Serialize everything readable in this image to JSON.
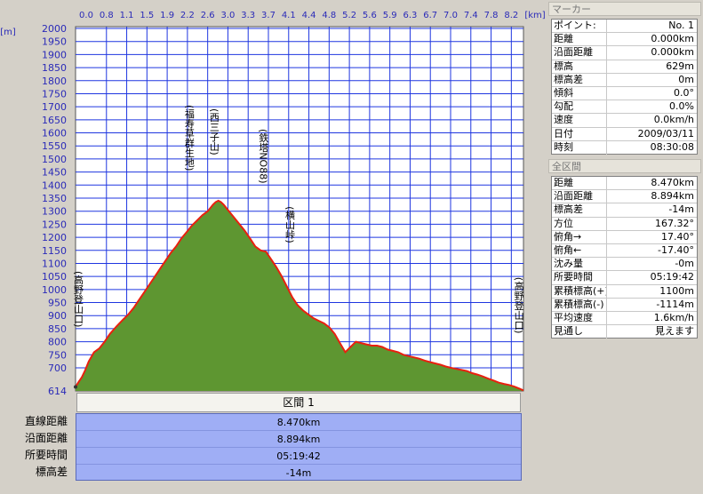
{
  "chart_data": {
    "type": "area",
    "x_unit": "[km]",
    "y_unit": "[m]",
    "x_ticks": [
      "0.0",
      "0.8",
      "1.1",
      "1.5",
      "1.9",
      "2.2",
      "2.6",
      "3.0",
      "3.3",
      "3.7",
      "4.1",
      "4.4",
      "4.8",
      "5.2",
      "5.6",
      "5.9",
      "6.3",
      "6.7",
      "7.0",
      "7.4",
      "7.8",
      "8.2"
    ],
    "y_ticks": [
      2000,
      1950,
      1900,
      1850,
      1800,
      1750,
      1700,
      1650,
      1600,
      1550,
      1500,
      1450,
      1400,
      1350,
      1300,
      1250,
      1200,
      1150,
      1100,
      1050,
      1000,
      950,
      900,
      850,
      800,
      750,
      700
    ],
    "y_min_label": "614",
    "xlim": [
      0,
      8.47
    ],
    "ylim": [
      614,
      2000
    ],
    "fill_color": "#5e9631",
    "line_color": "#e8200f",
    "grid_color": "#1f36e0",
    "plot_bg": "#ffffff",
    "x": [
      0.0,
      0.05,
      0.12,
      0.18,
      0.25,
      0.35,
      0.45,
      0.55,
      0.65,
      0.78,
      0.9,
      1.0,
      1.1,
      1.2,
      1.3,
      1.4,
      1.5,
      1.6,
      1.7,
      1.8,
      1.9,
      2.0,
      2.1,
      2.2,
      2.3,
      2.4,
      2.5,
      2.6,
      2.65,
      2.7,
      2.75,
      2.8,
      2.9,
      3.0,
      3.1,
      3.2,
      3.3,
      3.4,
      3.5,
      3.6,
      3.7,
      3.8,
      3.9,
      4.0,
      4.1,
      4.2,
      4.3,
      4.4,
      4.5,
      4.6,
      4.7,
      4.8,
      4.9,
      5.0,
      5.1,
      5.2,
      5.3,
      5.4,
      5.5,
      5.6,
      5.7,
      5.8,
      5.9,
      6.0,
      6.1,
      6.2,
      6.3,
      6.4,
      6.5,
      6.6,
      6.7,
      6.8,
      6.9,
      7.0,
      7.1,
      7.2,
      7.3,
      7.4,
      7.5,
      7.6,
      7.7,
      7.8,
      7.9,
      8.0,
      8.1,
      8.2,
      8.3,
      8.4,
      8.47
    ],
    "y": [
      629,
      645,
      665,
      690,
      725,
      760,
      775,
      800,
      830,
      860,
      885,
      905,
      930,
      960,
      990,
      1020,
      1050,
      1080,
      1110,
      1140,
      1165,
      1195,
      1220,
      1245,
      1265,
      1285,
      1300,
      1325,
      1335,
      1340,
      1335,
      1325,
      1300,
      1275,
      1250,
      1225,
      1195,
      1165,
      1150,
      1145,
      1115,
      1085,
      1050,
      1010,
      970,
      940,
      920,
      905,
      890,
      880,
      870,
      855,
      830,
      795,
      760,
      780,
      800,
      795,
      790,
      785,
      785,
      780,
      770,
      765,
      760,
      750,
      745,
      740,
      735,
      728,
      722,
      717,
      712,
      705,
      700,
      696,
      692,
      688,
      680,
      675,
      668,
      660,
      653,
      645,
      640,
      636,
      630,
      622,
      616
    ],
    "annotations": [
      {
        "text": "(高野登山口)",
        "x": 0.05
      },
      {
        "text": "(福寿草群生地)",
        "x": 2.15
      },
      {
        "text": "(西三子山)",
        "x": 2.62
      },
      {
        "text": "(鉄塔NO88)",
        "x": 3.55
      },
      {
        "text": "(横山峠)",
        "x": 4.05
      },
      {
        "text": "(高野登山口)",
        "x": 8.38
      }
    ]
  },
  "marker": {
    "title": "マーカー",
    "rows": [
      {
        "key": "ポイント:",
        "val": "No. 1"
      },
      {
        "key": "距離",
        "val": "0.000km"
      },
      {
        "key": "沿面距離",
        "val": "0.000km"
      },
      {
        "key": "標高",
        "val": "629m"
      },
      {
        "key": "標高差",
        "val": "0m"
      },
      {
        "key": "傾斜",
        "val": "0.0°"
      },
      {
        "key": "勾配",
        "val": "0.0%"
      },
      {
        "key": "速度",
        "val": "0.0km/h"
      },
      {
        "key": "日付",
        "val": "2009/03/11"
      },
      {
        "key": "時刻",
        "val": "08:30:08"
      }
    ]
  },
  "total": {
    "title": "全区間",
    "rows": [
      {
        "key": "距離",
        "val": "8.470km"
      },
      {
        "key": "沿面距離",
        "val": "8.894km"
      },
      {
        "key": "標高差",
        "val": "-14m"
      },
      {
        "key": "方位",
        "val": "167.32°"
      },
      {
        "key": "俯角→",
        "val": "17.40°"
      },
      {
        "key": "俯角←",
        "val": "-17.40°"
      },
      {
        "key": "沈み量",
        "val": "-0m"
      },
      {
        "key": "所要時間",
        "val": "05:19:42"
      },
      {
        "key": "累積標高(+)",
        "val": "1100m"
      },
      {
        "key": "累積標高(-)",
        "val": "-1114m"
      },
      {
        "key": "平均速度",
        "val": "1.6km/h"
      },
      {
        "key": "見通し",
        "val": "見えます"
      }
    ]
  },
  "segment": {
    "header": "区間 1",
    "labels": [
      "直線距離",
      "沿面距離",
      "所要時間",
      "標高差"
    ],
    "values": [
      "8.470km",
      "8.894km",
      "05:19:42",
      "-14m"
    ]
  }
}
